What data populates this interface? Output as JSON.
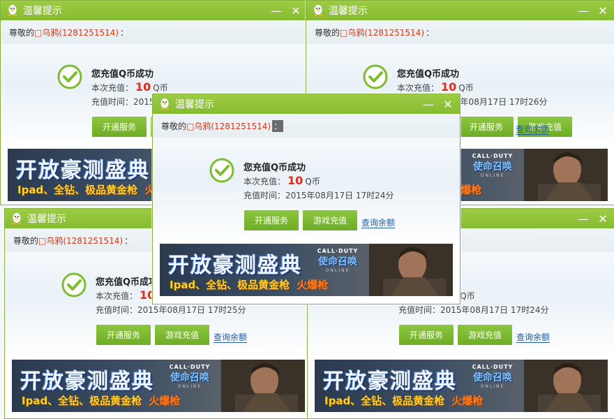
{
  "dialog": {
    "title": "温馨提示",
    "minimize_symbol": "—",
    "close_symbol": "✕",
    "greeting_prefix": "尊敬的",
    "user_nick": "□乌鸦(1281251514)",
    "colon": "：",
    "success_text": "您充值Q币成功",
    "amount_prefix": "本次充值：",
    "amount_value": "10",
    "amount_unit": "Q币",
    "time_prefix": "充值时间：",
    "open_service_label": "开通服务",
    "game_recharge_label": "游戏充值",
    "query_balance_label": "查询余额",
    "banner": {
      "title": "开放豪测盛典",
      "subtitle": "Ipad、全钻、极品黄金枪",
      "hot": "火爆枪",
      "logo_top": "CALL·DUTY",
      "logo_cn": "使命召唤",
      "logo_online": "ONLINE"
    }
  },
  "windows": [
    {
      "id": "top-left",
      "time": "2015年08月17日 17时26分"
    },
    {
      "id": "top-right",
      "time": "2015年08月17日 17时26分"
    },
    {
      "id": "bottom-left",
      "time": "2015年08月17日 17时25分"
    },
    {
      "id": "bottom-right",
      "time": "2015年08月17日 17时24分"
    },
    {
      "id": "center",
      "time": "2015年08月17日 17时24分"
    }
  ],
  "icons": {
    "title_icon": "qq-penguin-icon",
    "success_icon": "check-circle-icon"
  },
  "colors": {
    "titlebar": "#8cc03a",
    "button": "#7ab833",
    "accent_red": "#e02b1b",
    "link": "#1f5aa7"
  }
}
